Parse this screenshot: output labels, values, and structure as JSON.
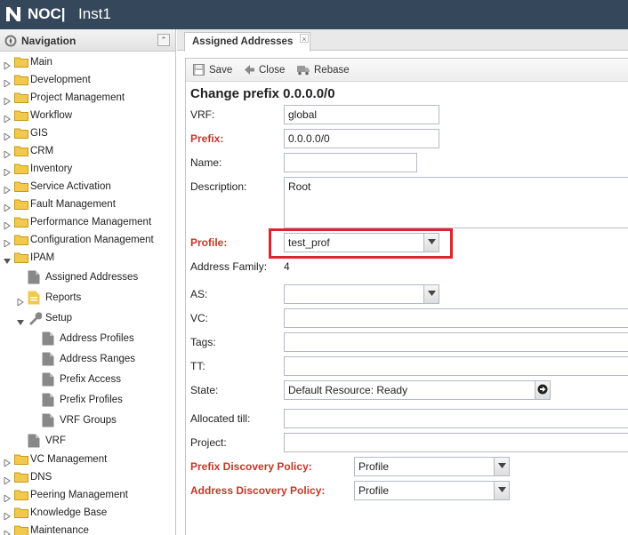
{
  "app": {
    "brand": "NOC|",
    "instance": "Inst1"
  },
  "navigation": {
    "title": "Navigation",
    "items": [
      {
        "label": "Main"
      },
      {
        "label": "Development"
      },
      {
        "label": "Project Management"
      },
      {
        "label": "Workflow"
      },
      {
        "label": "GIS"
      },
      {
        "label": "CRM"
      },
      {
        "label": "Inventory"
      },
      {
        "label": "Service Activation"
      },
      {
        "label": "Fault Management"
      },
      {
        "label": "Performance Management"
      },
      {
        "label": "Configuration Management"
      },
      {
        "label": "IPAM"
      }
    ],
    "ipam_children": {
      "assigned_addresses": "Assigned Addresses",
      "reports": "Reports",
      "setup": "Setup",
      "setup_children": [
        "Address Profiles",
        "Address Ranges",
        "Prefix Access",
        "Prefix Profiles",
        "VRF Groups"
      ],
      "vrf": "VRF"
    },
    "items_after": [
      {
        "label": "VC Management"
      },
      {
        "label": "DNS"
      },
      {
        "label": "Peering Management"
      },
      {
        "label": "Knowledge Base"
      },
      {
        "label": "Maintenance"
      }
    ]
  },
  "tab": {
    "label": "Assigned Addresses",
    "close": "×"
  },
  "toolbar": {
    "save": "Save",
    "close": "Close",
    "rebase": "Rebase"
  },
  "form": {
    "title": "Change prefix 0.0.0.0/0",
    "vrf": {
      "label": "VRF:",
      "value": "global"
    },
    "prefix": {
      "label": "Prefix:",
      "value": "0.0.0.0/0"
    },
    "name": {
      "label": "Name:",
      "value": ""
    },
    "description": {
      "label": "Description:",
      "value": "Root"
    },
    "profile": {
      "label": "Profile:",
      "value": "test_prof"
    },
    "address_family": {
      "label": "Address Family:",
      "value": "4"
    },
    "as": {
      "label": "AS:",
      "value": ""
    },
    "vc": {
      "label": "VC:",
      "value": ""
    },
    "tags": {
      "label": "Tags:",
      "value": ""
    },
    "tt": {
      "label": "TT:",
      "value": ""
    },
    "state": {
      "label": "State:",
      "value": "Default Resource: Ready"
    },
    "allocated_till": {
      "label": "Allocated till:",
      "value": ""
    },
    "project": {
      "label": "Project:",
      "value": ""
    },
    "prefix_discovery_policy": {
      "label": "Prefix Discovery Policy:",
      "value": "Profile"
    },
    "address_discovery_policy": {
      "label": "Address Discovery Policy:",
      "value": "Profile"
    }
  },
  "colors": {
    "topbar": "#35475a",
    "required_label": "#c0392b",
    "highlight": "#d9262f",
    "folder": "#f2c94c"
  }
}
